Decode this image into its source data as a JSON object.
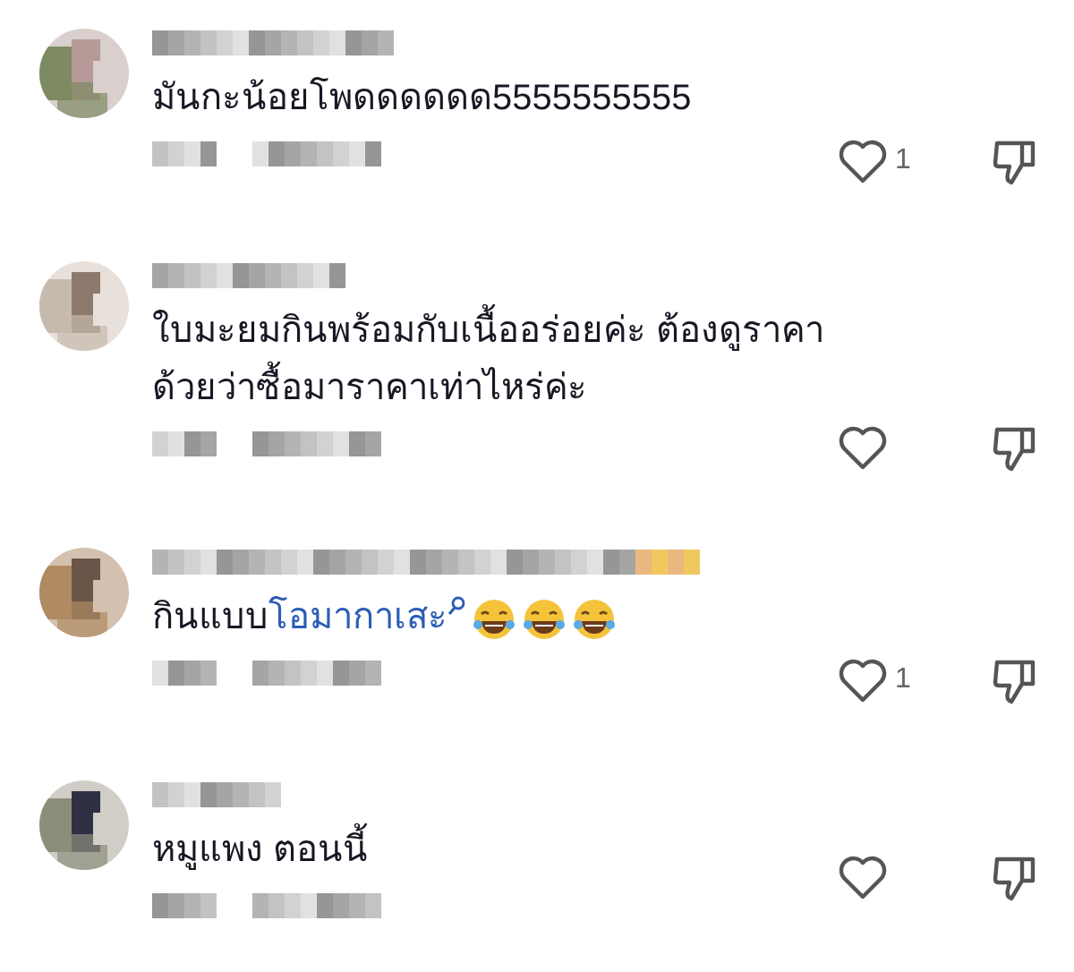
{
  "comments": [
    {
      "text": [
        {
          "kind": "text",
          "text": "มันกะน้อยโพดดดดดด5555555555"
        }
      ],
      "likes": "1"
    },
    {
      "text": [
        {
          "kind": "text",
          "text": "ใบมะยมกินพร้อมกับเนื้ออร่อยค่ะ ต้องดูราคาด้วยว่าซื้อมาราคาเท่าไหร่ค่ะ"
        }
      ]
    },
    {
      "text": [
        {
          "kind": "text",
          "text": "กินแบบ"
        },
        {
          "kind": "link",
          "text": "โอมากาเสะ"
        },
        {
          "kind": "emoji"
        },
        {
          "kind": "emoji"
        },
        {
          "kind": "emoji"
        }
      ],
      "likes": "1"
    },
    {
      "text": [
        {
          "kind": "text",
          "text": "หมูแพง ตอนนี้"
        }
      ]
    }
  ]
}
